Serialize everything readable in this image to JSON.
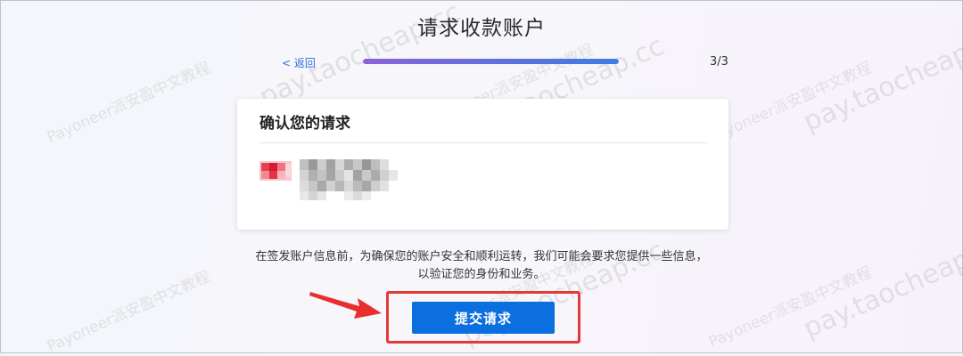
{
  "header": {
    "title": "请求收款账户",
    "back_label": "< 返回",
    "step_count": "3/3",
    "progress_fraction": 1.0
  },
  "card": {
    "title": "确认您的请求"
  },
  "notice": {
    "line1": "在签发账户信息前，为确保您的账户安全和顺利运转，我们可能会要求您提供一些信息，",
    "line2": "以验证您的身份和业务。"
  },
  "actions": {
    "submit_label": "提交请求"
  },
  "watermark": {
    "text_a": "Payoneer派安盈中文教程",
    "text_b": "pay.taocheap.cc"
  },
  "colors": {
    "accent": "#0c6fe0",
    "highlight": "#e53935",
    "progress_start": "#8a63d8",
    "progress_end": "#3f7ce3"
  }
}
